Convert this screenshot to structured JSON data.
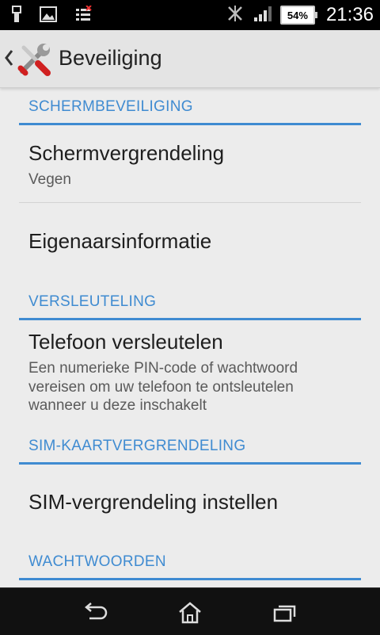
{
  "status_bar": {
    "time": "21:36",
    "battery_percent": "54%",
    "icons": [
      "usb-icon",
      "image-icon",
      "bars-icon",
      "bluetooth-icon",
      "signal-icon",
      "battery-icon"
    ]
  },
  "action_bar": {
    "title": "Beveiliging",
    "icon": "tools-icon"
  },
  "sections": [
    {
      "header": "SCHERMBEVEILIGING",
      "items": [
        {
          "title": "Schermvergrendeling",
          "summary": "Vegen"
        },
        {
          "title": "Eigenaarsinformatie"
        }
      ]
    },
    {
      "header": "VERSLEUTELING",
      "items": [
        {
          "title": "Telefoon versleutelen",
          "summary": "Een numerieke PIN-code of wachtwoord vereisen om uw telefoon te ontsleutelen wanneer u deze inschakelt"
        }
      ]
    },
    {
      "header": "SIM-KAARTVERGRENDELING",
      "items": [
        {
          "title": "SIM-vergrendeling instellen"
        }
      ]
    },
    {
      "header": "WACHTWOORDEN",
      "items": []
    }
  ],
  "nav_bar": {
    "buttons": [
      "back-icon",
      "home-icon",
      "recent-apps-icon"
    ]
  },
  "colors": {
    "accent": "#3f8bd1",
    "background": "#ececec",
    "status_bar": "#000000",
    "nav_bar": "#111111"
  }
}
